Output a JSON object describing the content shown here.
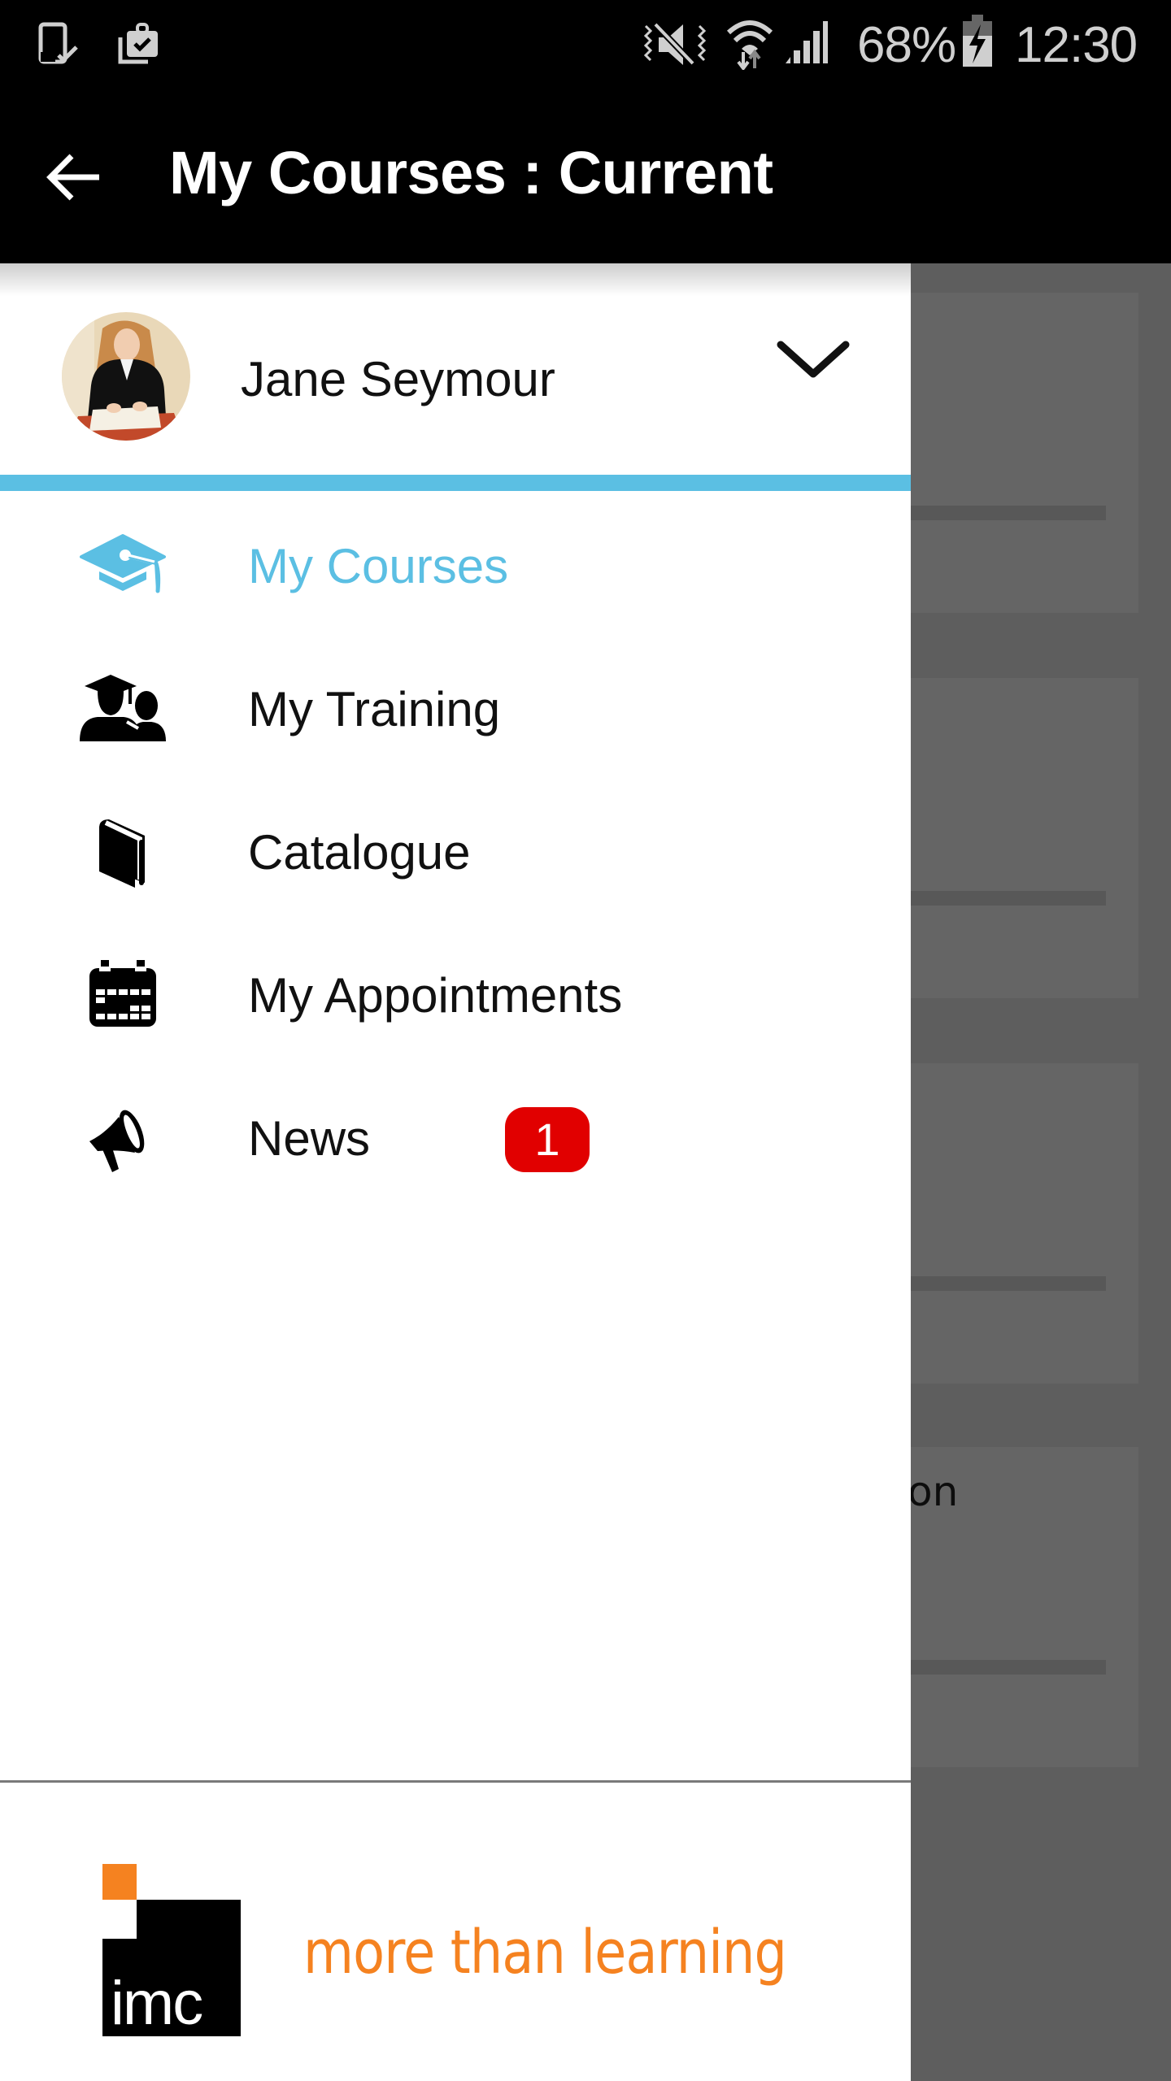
{
  "status_bar": {
    "icons_left": [
      "device-check-icon",
      "briefcase-check-icon"
    ],
    "icons_right": [
      "vibrate-mute-icon",
      "wifi-icon",
      "signal-icon",
      "battery-charging-icon"
    ],
    "battery_percent": "68%",
    "time": "12:30"
  },
  "app_bar": {
    "back_icon": "arrow-left-icon",
    "title": "My Courses : Current"
  },
  "drawer": {
    "user": {
      "name": "Jane Seymour",
      "toggle_icon": "chevron-down-icon"
    },
    "nav_items": [
      {
        "label": "My Courses",
        "icon": "graduation-cap-icon",
        "active": true
      },
      {
        "label": "My Training",
        "icon": "graduate-users-icon",
        "active": false
      },
      {
        "label": "Catalogue",
        "icon": "book-icon",
        "active": false
      },
      {
        "label": "My Appointments",
        "icon": "calendar-icon",
        "active": false
      },
      {
        "label": "News",
        "icon": "megaphone-icon",
        "active": false,
        "badge": "1"
      }
    ],
    "footer": {
      "logo_text": "imc",
      "tagline": "more than learning"
    }
  },
  "background_content": {
    "card_title_fragment": "on"
  },
  "colors": {
    "accent": "#5bbfe3",
    "badge": "#e10000",
    "brand_orange": "#f58220",
    "app_bar": "#000000",
    "scrim": "#5e5e5e"
  }
}
